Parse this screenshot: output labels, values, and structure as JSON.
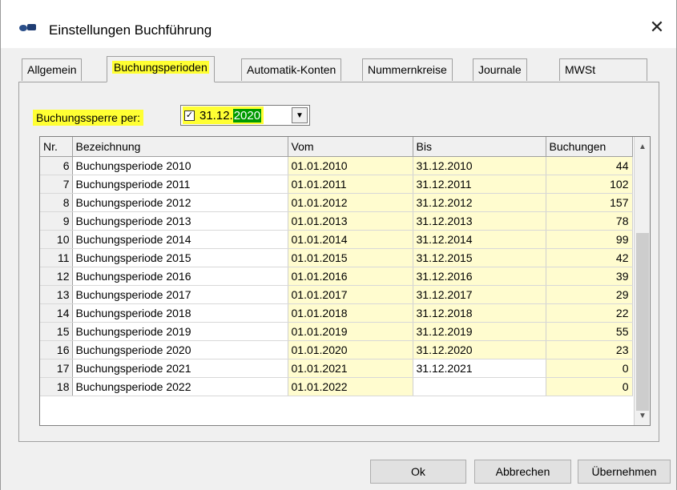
{
  "window": {
    "title": "Einstellungen Buchführung",
    "icon": "app-icon",
    "close": "✕"
  },
  "tabs": [
    {
      "label": "Allgemein",
      "active": false
    },
    {
      "label": "Buchungsperioden",
      "active": true
    },
    {
      "label": "Automatik-Konten",
      "active": false
    },
    {
      "label": "Nummernkreise",
      "active": false
    },
    {
      "label": "Journale",
      "active": false
    },
    {
      "label": "MWSt",
      "active": false
    }
  ],
  "lock": {
    "label": "Buchungssperre per:",
    "checked": "✓",
    "date_prefix": "31.12.",
    "date_selected": "2020",
    "drop": "▼"
  },
  "grid": {
    "headers": [
      "Nr.",
      "Bezeichnung",
      "Vom",
      "Bis",
      "Buchungen"
    ],
    "rows": [
      [
        "6",
        "Buchungsperiode 2010",
        "01.01.2010",
        "31.12.2010",
        "44"
      ],
      [
        "7",
        "Buchungsperiode 2011",
        "01.01.2011",
        "31.12.2011",
        "102"
      ],
      [
        "8",
        "Buchungsperiode 2012",
        "01.01.2012",
        "31.12.2012",
        "157"
      ],
      [
        "9",
        "Buchungsperiode 2013",
        "01.01.2013",
        "31.12.2013",
        "78"
      ],
      [
        "10",
        "Buchungsperiode 2014",
        "01.01.2014",
        "31.12.2014",
        "99"
      ],
      [
        "11",
        "Buchungsperiode 2015",
        "01.01.2015",
        "31.12.2015",
        "42"
      ],
      [
        "12",
        "Buchungsperiode 2016",
        "01.01.2016",
        "31.12.2016",
        "39"
      ],
      [
        "13",
        "Buchungsperiode 2017",
        "01.01.2017",
        "31.12.2017",
        "29"
      ],
      [
        "14",
        "Buchungsperiode 2018",
        "01.01.2018",
        "31.12.2018",
        "22"
      ],
      [
        "15",
        "Buchungsperiode 2019",
        "01.01.2019",
        "31.12.2019",
        "55"
      ],
      [
        "16",
        "Buchungsperiode 2020",
        "01.01.2020",
        "31.12.2020",
        "23"
      ],
      [
        "17",
        "Buchungsperiode 2021",
        "01.01.2021",
        "31.12.2021",
        "0"
      ],
      [
        "18",
        "Buchungsperiode 2022",
        "01.01.2022",
        "",
        "0"
      ]
    ],
    "scroll_up": "▲",
    "scroll_down": "▼"
  },
  "buttons": {
    "ok": "Ok",
    "cancel": "Abbrechen",
    "apply": "Übernehmen"
  },
  "colors": {
    "highlight": "#ffff33",
    "cell_yellow": "#fffccf",
    "selection": "#009a00"
  }
}
